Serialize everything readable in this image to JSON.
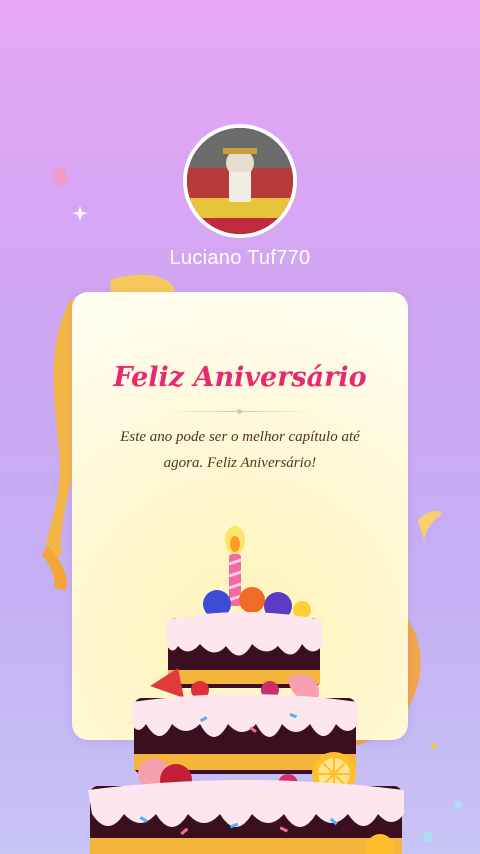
{
  "profile": {
    "username": "Luciano Tuf770"
  },
  "card": {
    "title": "Feliz Aniversário",
    "message": "Este ano pode ser o melhor capítulo até agora. Feliz Aniversário!"
  },
  "colors": {
    "background_top": "#e7a6f7",
    "background_bottom": "#c8c4f6",
    "title": "#e8296f",
    "card": "#fff7cf",
    "ribbon": "#f5b83c"
  }
}
